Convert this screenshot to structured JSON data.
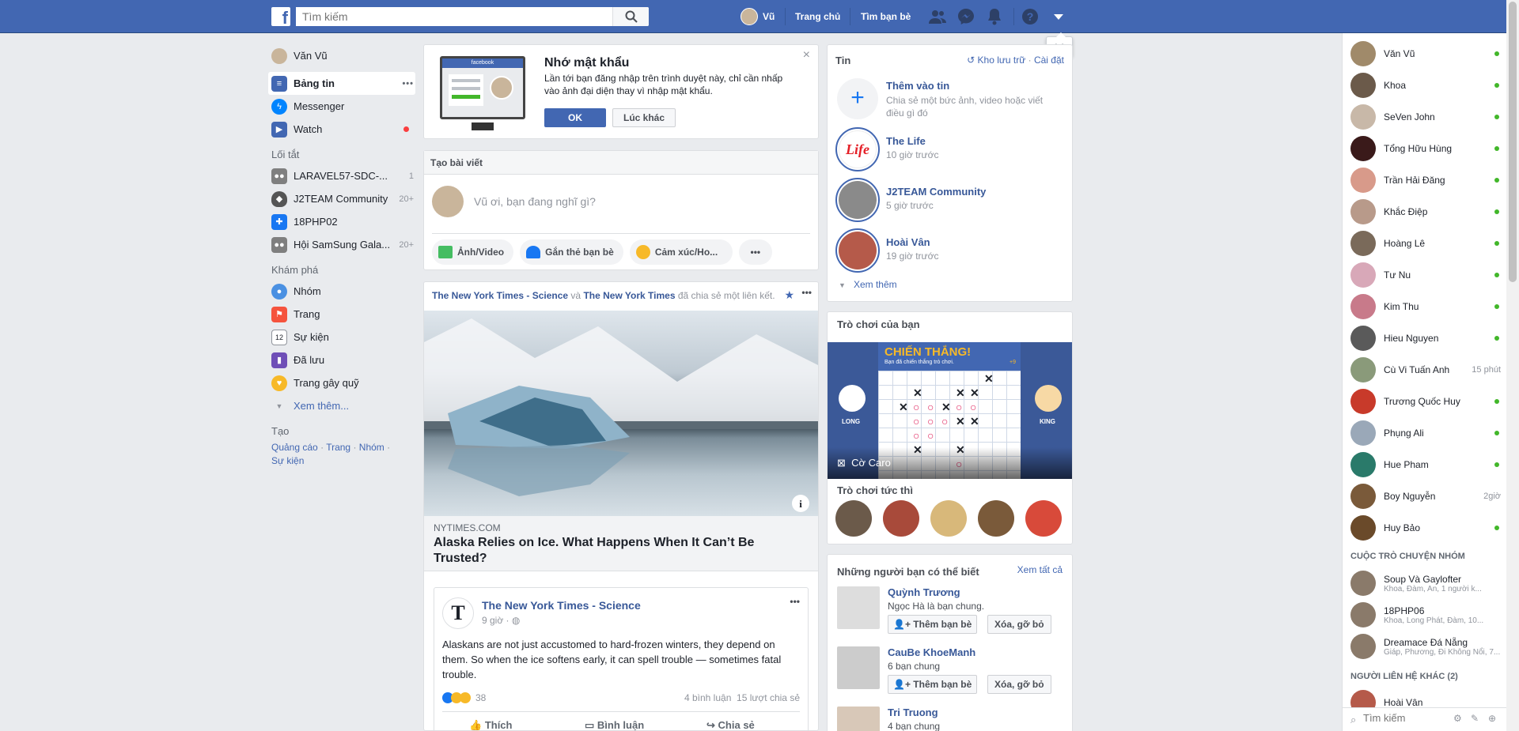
{
  "topbar": {
    "logo": "f",
    "search_placeholder": "Tìm kiếm",
    "user_name": "Vũ",
    "home_label": "Trang chủ",
    "find_friends_label": "Tìm bạn bè"
  },
  "left": {
    "profile_name": "Văn Vũ",
    "main_items": [
      {
        "label": "Bảng tin",
        "icon": "newsfeed-icon",
        "color": "#4267b2"
      },
      {
        "label": "Messenger",
        "icon": "messenger-icon",
        "color": "#0084ff"
      },
      {
        "label": "Watch",
        "icon": "watch-icon",
        "color": "#4267b2"
      }
    ],
    "more_dots": "•••",
    "shortcuts_title": "Lối tắt",
    "shortcuts": [
      {
        "label": "LARAVEL57-SDC-...",
        "count": "1",
        "color": "#7f7f7f"
      },
      {
        "label": "J2TEAM Community",
        "count": "20+",
        "color": "#555"
      },
      {
        "label": "18PHP02",
        "count": "",
        "color": "#1877f2"
      },
      {
        "label": "Hội SamSung Gala...",
        "count": "20+",
        "color": "#7f7f7f"
      }
    ],
    "explore_title": "Khám phá",
    "explore": [
      {
        "label": "Nhóm",
        "color": "#4a90e2"
      },
      {
        "label": "Trang",
        "color": "#f5533d"
      },
      {
        "label": "Sự kiện",
        "color": "#e9ebee"
      },
      {
        "label": "Đã lưu",
        "color": "#6f4fb7"
      },
      {
        "label": "Trang gây quỹ",
        "color": "#f7b928"
      }
    ],
    "see_more": "Xem thêm...",
    "create_title": "Tạo",
    "create_links": [
      "Quảng cáo",
      "Trang",
      "Nhóm",
      "Sự kiện"
    ],
    "separator": "·",
    "calendar_num": "12"
  },
  "remember": {
    "title": "Nhớ mật khẩu",
    "body": "Lần tới bạn đăng nhập trên trình duyệt này, chỉ cần nhấp vào ảnh đại diện thay vì nhập mật khẩu.",
    "ok": "OK",
    "later": "Lúc khác",
    "monitor_brand": "facebook"
  },
  "composer": {
    "title": "Tạo bài viết",
    "placeholder": "Vũ ơi, bạn đang nghĩ gì?",
    "actions": [
      "Ảnh/Video",
      "Gắn thẻ bạn bè",
      "Cảm xúc/Ho..."
    ]
  },
  "post": {
    "source1": "The New York Times - Science",
    "and": "và",
    "source2": "The New York Times",
    "shared": "đã chia sẻ một liên kết.",
    "domain": "NYTIMES.COM",
    "headline": "Alaska Relies on Ice. What Happens When It Can’t Be Trusted?",
    "inner_author": "The New York Times - Science",
    "inner_time": "9 giờ ·",
    "inner_text": "Alaskans are not just accustomed to hard-frozen winters, they depend on them. So when the ice softens early, it can spell trouble — sometimes fatal trouble.",
    "reactions": "38",
    "comments": "4 bình luận",
    "shares": "15 lượt chia sẻ",
    "like": "Thích",
    "comment": "Bình luận",
    "share": "Chia sẻ",
    "info": "i",
    "avatar_letter": "T"
  },
  "stories": {
    "title": "Tin",
    "archive": "Kho lưu trữ",
    "settings": "Cài đặt",
    "dot": "·",
    "add_title": "Thêm vào tin",
    "add_desc": "Chia sẻ một bức ảnh, video hoặc viết điều gì đó",
    "add_plus": "+",
    "life_label": "Life",
    "items": [
      {
        "name": "The Life",
        "time": "10 giờ trước",
        "color": "#ffffff"
      },
      {
        "name": "J2TEAM Community",
        "time": "5 giờ trước",
        "color": "#8a8a8a"
      },
      {
        "name": "Hoài Vân",
        "time": "19 giờ trước",
        "color": "#b55a4a"
      }
    ],
    "see_more": "Xem thêm"
  },
  "games": {
    "title": "Trò chơi của bạn",
    "banner_title": "CHIẾN THẮNG!",
    "banner_sub": "Bạn đã chiến thắng trò chơi.",
    "score": "+9",
    "player_left": "LONG",
    "player_right": "KING",
    "game_name": "Cờ Caro",
    "instant_title": "Trò chơi tức thì",
    "x_mark": "✕",
    "o_mark": "○"
  },
  "pymk": {
    "title": "Những người bạn có thể biết",
    "see_all": "Xem tất cả",
    "add": "Thêm bạn bè",
    "remove": "Xóa, gỡ bỏ",
    "people": [
      {
        "name": "Quỳnh Trương",
        "sub": "Ngọc Hà là bạn chung."
      },
      {
        "name": "CauBe KhoeManh",
        "sub": "6 bạn chung"
      },
      {
        "name": "Tri Truong",
        "sub": "4 bạn chung"
      }
    ]
  },
  "chat": {
    "contacts": [
      {
        "name": "Văn Vũ",
        "status": "dot",
        "color": "#a08a6a"
      },
      {
        "name": "Khoa",
        "status": "dot",
        "color": "#6b5a4a"
      },
      {
        "name": "SeVen John",
        "status": "dot",
        "color": "#c8b8a8"
      },
      {
        "name": "Tổng Hữu Hùng",
        "status": "dot",
        "color": "#3a1a1a"
      },
      {
        "name": "Trần Hải Đăng",
        "status": "dot",
        "color": "#d89a8a"
      },
      {
        "name": "Khắc Điệp",
        "status": "dot",
        "color": "#b89a8a"
      },
      {
        "name": "Hoàng Lê",
        "status": "dot",
        "color": "#7a6a5a"
      },
      {
        "name": "Tư Nu",
        "status": "dot",
        "color": "#d8a8b8"
      },
      {
        "name": "Kim Thu",
        "status": "dot",
        "color": "#c87a8a"
      },
      {
        "name": "Hieu Nguyen",
        "status": "dot",
        "color": "#5a5a5a"
      },
      {
        "name": "Cù Vi Tuấn Anh",
        "status": "15 phút",
        "color": "#8a9a7a"
      },
      {
        "name": "Trương Quốc Huy",
        "status": "dot",
        "color": "#c83a2a"
      },
      {
        "name": "Phụng Ali",
        "status": "dot",
        "color": "#9aa8b8"
      },
      {
        "name": "Hue Pham",
        "status": "dot",
        "color": "#2a7a6a"
      },
      {
        "name": "Boy Nguyễn",
        "status": "2giờ",
        "color": "#7a5a3a"
      },
      {
        "name": "Huy Bảo",
        "status": "dot",
        "color": "#6a4a2a"
      }
    ],
    "group_title": "CUỘC TRÒ CHUYỆN NHÓM",
    "groups": [
      {
        "name": "Soup Và Gaylofter",
        "sub": "Khoa, Đàm, An, 1 người k..."
      },
      {
        "name": "18PHP06",
        "sub": "Khoa, Long Phát, Đàm, 10..."
      },
      {
        "name": "Dreamace Đá Nẵng",
        "sub": "Giáp, Phương, Đi Không Nổi, 7..."
      }
    ],
    "other_title": "NGƯỜI LIÊN HỆ KHÁC (2)",
    "other_first": "Hoài Vân",
    "search_placeholder": "Tìm kiếm"
  }
}
